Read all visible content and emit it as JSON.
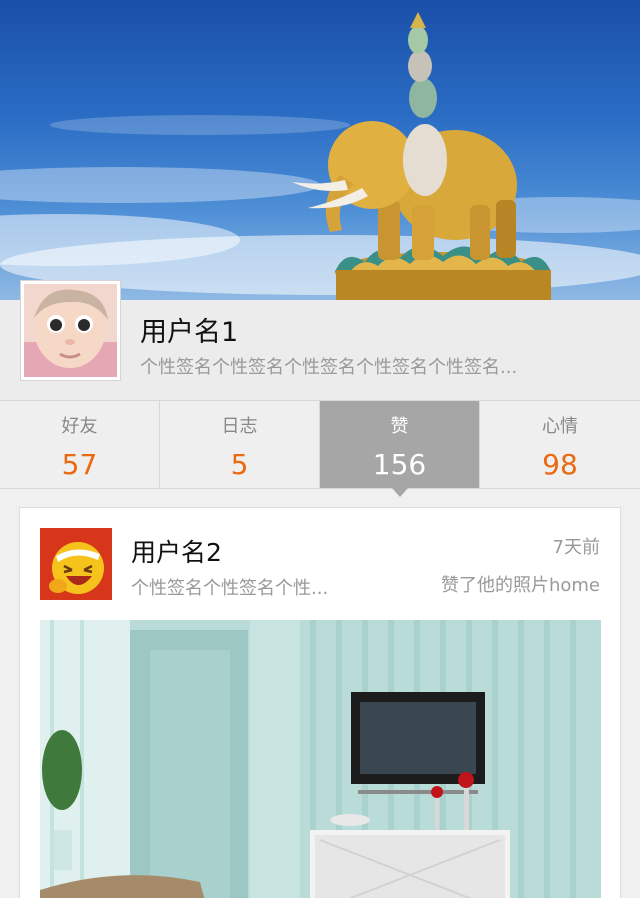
{
  "cover": {
    "image": "elephant-statue-sky"
  },
  "profile": {
    "avatar": "baby-portrait",
    "username": "用户名1",
    "signature": "个性签名个性签名个性签名个性签名个性签名..."
  },
  "stats": [
    {
      "label": "好友",
      "count": "57"
    },
    {
      "label": "日志",
      "count": "5"
    },
    {
      "label": "赞",
      "count": "156",
      "active": true
    },
    {
      "label": "心情",
      "count": "98"
    }
  ],
  "feed": {
    "item": {
      "avatar": "laughing-emoji",
      "username": "用户名2",
      "signature": "个性签名个性签名个性...",
      "time": "7天前",
      "action": "赞了他的照片home",
      "photo": "living-room-interior"
    }
  },
  "colors": {
    "accent": "#ea6a12",
    "active_tab": "#a6a6a6",
    "muted_text": "#999999"
  }
}
